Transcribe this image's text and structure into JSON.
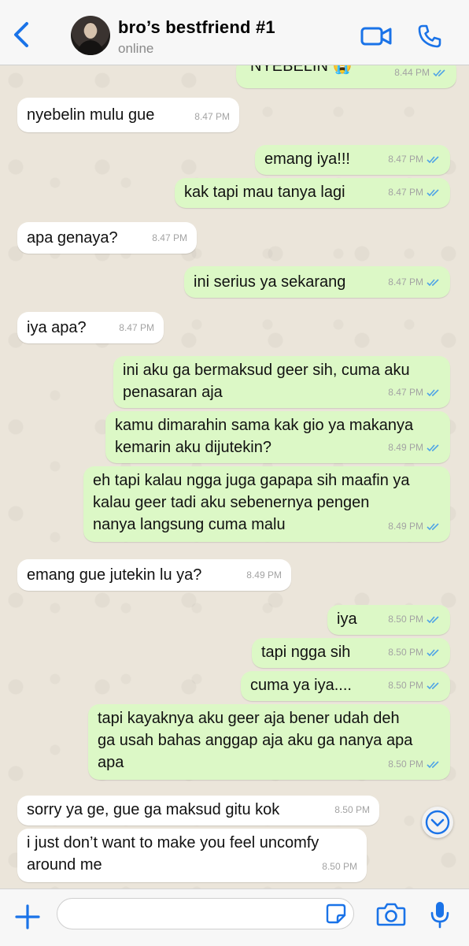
{
  "header": {
    "contact_name": "bro’s bestfriend #1",
    "status": "online"
  },
  "colors": {
    "accent": "#1a73e8",
    "outgoing_bubble": "#dcf8c6",
    "incoming_bubble": "#ffffff",
    "read_ticks": "#4fa3e6"
  },
  "icons": [
    "back-icon",
    "video-call-icon",
    "phone-icon",
    "read-ticks-icon",
    "chevron-down-icon",
    "plus-icon",
    "sticker-icon",
    "camera-icon",
    "microphone-icon"
  ],
  "messages": [
    {
      "dir": "out",
      "text": "NYEBELIN 😭",
      "time": "8.44 PM"
    },
    {
      "dir": "in",
      "text": "nyebelin mulu gue",
      "time": "8.47 PM"
    },
    {
      "dir": "out",
      "text": "emang iya!!!",
      "time": "8.47 PM"
    },
    {
      "dir": "out",
      "text": "kak tapi mau tanya lagi",
      "time": "8.47 PM"
    },
    {
      "dir": "in",
      "text": "apa genaya?",
      "time": "8.47 PM"
    },
    {
      "dir": "out",
      "text": "ini serius ya sekarang",
      "time": "8.47 PM"
    },
    {
      "dir": "in",
      "text": "iya apa?",
      "time": "8.47 PM"
    },
    {
      "dir": "out",
      "text": "ini aku ga bermaksud geer sih, cuma aku\npenasaran aja",
      "time": "8.47 PM"
    },
    {
      "dir": "out",
      "text": "kamu dimarahin sama kak gio ya makanya\nkemarin aku dijutekin?",
      "time": "8.49 PM"
    },
    {
      "dir": "out",
      "text": "eh tapi kalau ngga juga gapapa sih maafin ya\nkalau geer tadi aku sebenernya pengen\nnanya langsung cuma malu",
      "time": "8.49 PM"
    },
    {
      "dir": "in",
      "text": "emang gue jutekin lu ya?",
      "time": "8.49 PM"
    },
    {
      "dir": "out",
      "text": "iya",
      "time": "8.50 PM"
    },
    {
      "dir": "out",
      "text": "tapi ngga sih",
      "time": "8.50 PM"
    },
    {
      "dir": "out",
      "text": "cuma ya iya....",
      "time": "8.50 PM"
    },
    {
      "dir": "out",
      "text": "tapi kayaknya aku geer aja bener udah deh\nga usah bahas anggap aja aku ga nanya apa\napa",
      "time": "8.50 PM"
    },
    {
      "dir": "in",
      "text": "sorry ya ge, gue ga maksud gitu kok",
      "time": "8.50 PM"
    },
    {
      "dir": "in",
      "text": "i just don’t want to make you feel uncomfy\naround me",
      "time": "8.50 PM"
    }
  ],
  "composer": {
    "value": "",
    "placeholder": ""
  }
}
